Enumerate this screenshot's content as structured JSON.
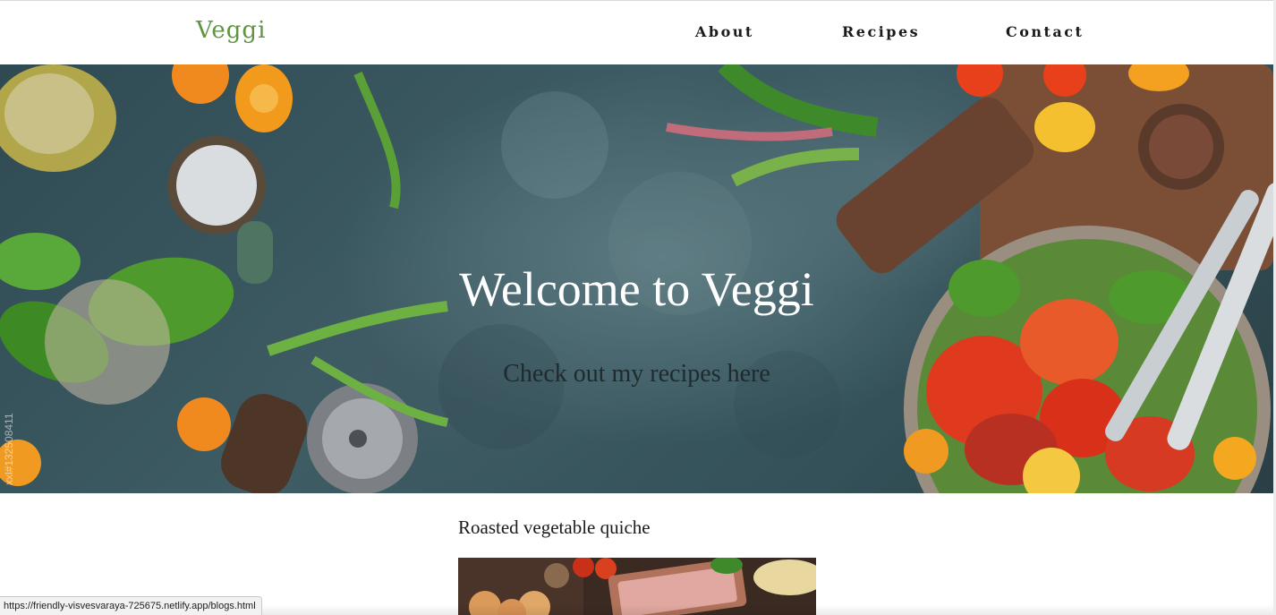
{
  "navbar": {
    "brand": "Veggi",
    "links": [
      {
        "label": "About"
      },
      {
        "label": "Recipes"
      },
      {
        "label": "Contact"
      }
    ]
  },
  "hero": {
    "title": "Welcome to Veggi",
    "subtitle": "Check out my recipes here",
    "watermark": "xxl#132508411"
  },
  "post": {
    "title": "Roasted vegetable quiche"
  },
  "status_bar": {
    "url": "https://friendly-visvesvaraya-725675.netlify.app/blogs.html"
  },
  "colors": {
    "brand": "#5f9441",
    "nav_text": "#1a1a1a",
    "hero_bg": "#3e5c64",
    "hero_title": "#ffffff",
    "hero_subtitle": "#1f2a2e"
  }
}
